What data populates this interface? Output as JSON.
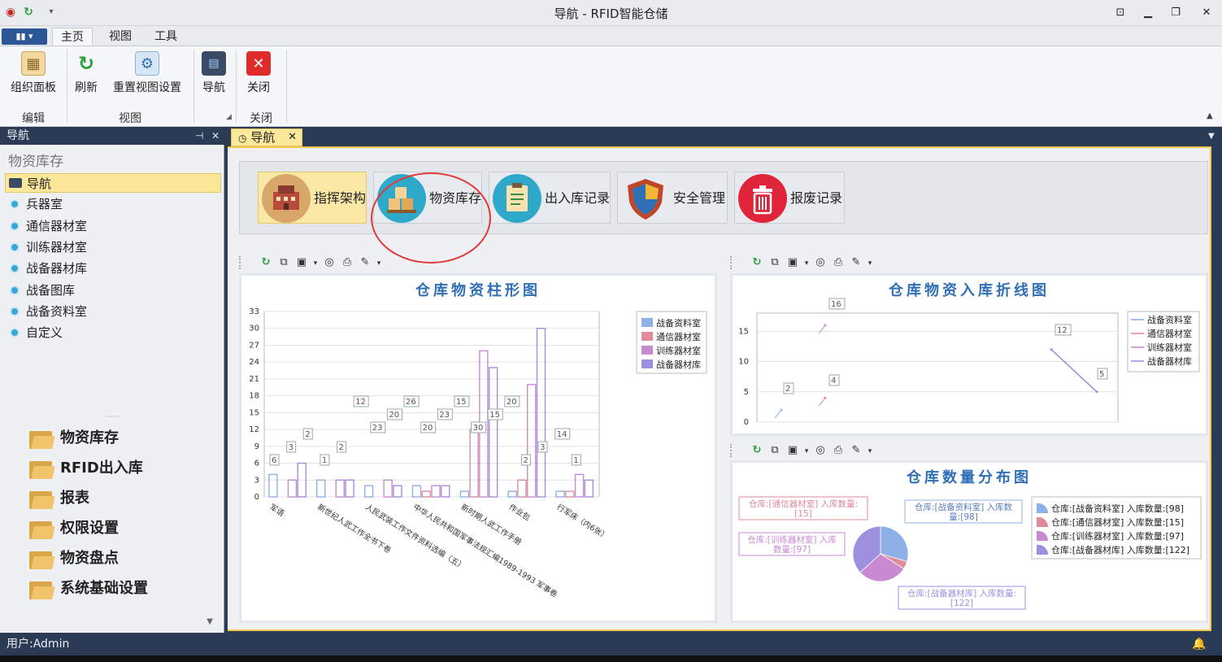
{
  "titlebar": {
    "title": "导航 - RFID智能仓储",
    "min": "▁",
    "restore": "❐",
    "close": "✕",
    "pin": "⊡"
  },
  "ribbon_tabs": {
    "app_menu": "▮▮ ▾",
    "tabs": [
      "主页",
      "视图",
      "工具"
    ]
  },
  "ribbon": {
    "buttons": [
      "组织面板",
      "刷新",
      "重置视图设置",
      "导航",
      "关闭"
    ],
    "groups": [
      "编辑",
      "视图",
      "关闭"
    ]
  },
  "navpane": {
    "header": "导航",
    "group_title": "物资库存",
    "items": [
      "导航",
      "兵器室",
      "通信器材室",
      "训练器材室",
      "战备器材库",
      "战备图库",
      "战备资料室",
      "自定义"
    ],
    "bottom_groups": [
      "物资库存",
      "RFID出入库",
      "报表",
      "权限设置",
      "物资盘点",
      "系统基础设置"
    ]
  },
  "doc": {
    "tab_label": "导航"
  },
  "modules": [
    "指挥架构",
    "物资库存",
    "出入库记录",
    "安全管理",
    "报废记录"
  ],
  "colors": {
    "brand_dark": "#2b3a55",
    "accent_yellow": "#fbe89b",
    "title_blue": "#2f6fb5",
    "series": [
      "#8fb0e6",
      "#e08a9a",
      "#c98ad1",
      "#9f8fe0"
    ]
  },
  "chart_data": [
    {
      "type": "bar",
      "title": "仓库物资柱形图",
      "ylim": [
        0,
        33
      ],
      "yticks": [
        0,
        3,
        6,
        9,
        12,
        15,
        18,
        21,
        24,
        27,
        30,
        33
      ],
      "categories": [
        "军语",
        "新世纪人武工作全书下卷",
        "人民武装工作文件资料选编（五）",
        "中华人民共和国军事法规汇编1989-1993 军事卷",
        "新时期人武工作手册",
        "作业包",
        "行军床（内6张）"
      ],
      "series": [
        {
          "name": "战备资料室",
          "values": [
            4,
            3,
            2,
            2,
            1,
            1,
            1
          ]
        },
        {
          "name": "通信器材室",
          "values": [
            0,
            0,
            0,
            1,
            12,
            3,
            1
          ]
        },
        {
          "name": "训练器材室",
          "values": [
            3,
            3,
            3,
            2,
            26,
            20,
            4
          ]
        },
        {
          "name": "战备器材库",
          "values": [
            6,
            3,
            2,
            2,
            23,
            30,
            3
          ]
        }
      ],
      "data_labels": [
        "6",
        "3",
        "2",
        "1",
        "2",
        "12",
        "23",
        "20",
        "26",
        "20",
        "23",
        "15",
        "30",
        "15",
        "20",
        "2",
        "3",
        "14",
        "1"
      ]
    },
    {
      "type": "line",
      "title": "仓库物资入库折线图",
      "ylim": [
        0,
        18
      ],
      "yticks": [
        0,
        5,
        10,
        15
      ],
      "series": [
        {
          "name": "战备资料室",
          "values": [
            2
          ]
        },
        {
          "name": "通信器材室",
          "values": [
            4
          ]
        },
        {
          "name": "训练器材室",
          "values": [
            16
          ]
        },
        {
          "name": "战备器材库",
          "values": [
            12,
            5
          ]
        }
      ],
      "data_labels": [
        "16",
        "2",
        "4",
        "12",
        "5"
      ]
    },
    {
      "type": "pie",
      "title": "仓库数量分布图",
      "slices": [
        {
          "name": "仓库:[战备资料室] 入库数量:[98]",
          "label": "仓库:[战备资料室] 入库数量:[98]",
          "value": 98
        },
        {
          "name": "仓库:[通信器材室] 入库数量:[15]",
          "label": "仓库:[通信器材室] 入库数量:[15]",
          "value": 15
        },
        {
          "name": "仓库:[训练器材室] 入库数量:[97]",
          "label": "仓库:[训练器材室] 入库数量:[97]",
          "value": 97
        },
        {
          "name": "仓库:[战备器材库] 入库数量:[122]",
          "label": "仓库:[战备器材库] 入库数量:[122]",
          "value": 122
        }
      ]
    }
  ],
  "statusbar": {
    "user": "用户:Admin"
  }
}
